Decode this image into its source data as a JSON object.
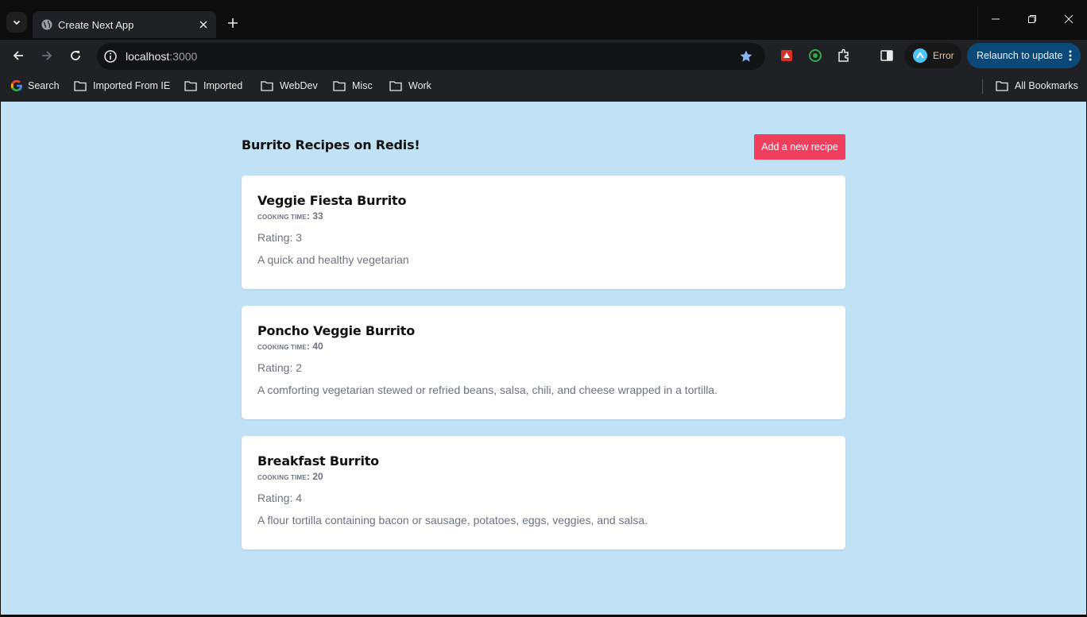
{
  "browser": {
    "tab": {
      "title": "Create Next App"
    },
    "url": {
      "host": "localhost",
      "port": ":3000"
    },
    "error_chip": "Error",
    "relaunch": "Relaunch to update",
    "bookmarks": [
      {
        "label": "Search",
        "icon": "google-icon"
      },
      {
        "label": "Imported From IE",
        "icon": "folder-icon"
      },
      {
        "label": "Imported",
        "icon": "folder-icon"
      },
      {
        "label": "WebDev",
        "icon": "folder-icon"
      },
      {
        "label": "Misc",
        "icon": "folder-icon"
      },
      {
        "label": "Work",
        "icon": "folder-icon"
      }
    ],
    "all_bookmarks": "All Bookmarks"
  },
  "page": {
    "title": "Burrito Recipes on Redis!",
    "add_button": "Add a new recipe",
    "cooking_time_label": "COOKING TIME",
    "recipes": [
      {
        "name": "Veggie Fiesta Burrito",
        "cooking_time": "33",
        "rating": "Rating: 3",
        "description": "A quick and healthy vegetarian"
      },
      {
        "name": "Poncho Veggie Burrito",
        "cooking_time": "40",
        "rating": "Rating: 2",
        "description": "A comforting vegetarian stewed or refried beans, salsa, chili, and cheese wrapped in a tortilla."
      },
      {
        "name": "Breakfast Burrito",
        "cooking_time": "20",
        "rating": "Rating: 4",
        "description": "A flour tortilla containing bacon or sausage, potatoes, eggs, veggies, and salsa."
      }
    ]
  },
  "colors": {
    "page_background": "#c1e1f4",
    "accent_button": "#f03e5e",
    "relaunch_chip": "#0b4a78"
  }
}
